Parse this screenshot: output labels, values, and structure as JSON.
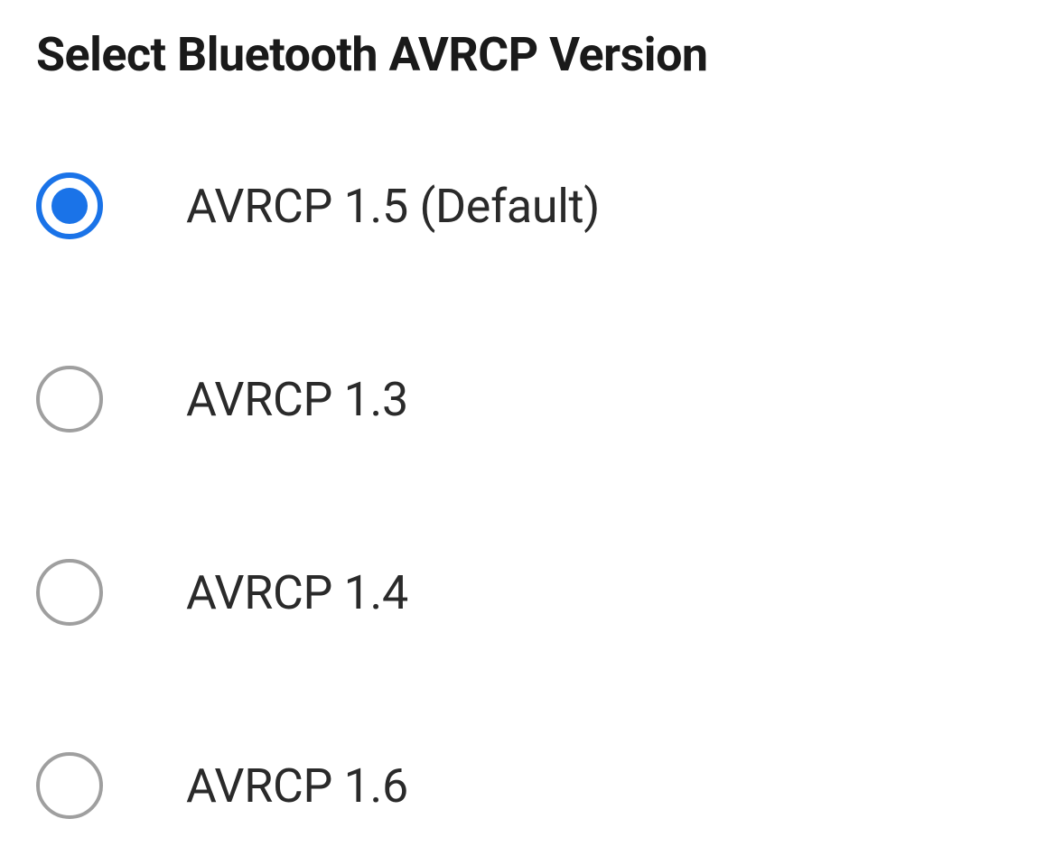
{
  "dialog": {
    "title": "Select Bluetooth AVRCP Version",
    "selectedIndex": 0,
    "options": [
      {
        "label": "AVRCP 1.5 (Default)",
        "id": "avrcp-1-5"
      },
      {
        "label": "AVRCP 1.3",
        "id": "avrcp-1-3"
      },
      {
        "label": "AVRCP 1.4",
        "id": "avrcp-1-4"
      },
      {
        "label": "AVRCP 1.6",
        "id": "avrcp-1-6"
      }
    ]
  },
  "colors": {
    "accent": "#1a73e8",
    "text": "#1a1a1a",
    "radioBorder": "#9f9f9f"
  }
}
